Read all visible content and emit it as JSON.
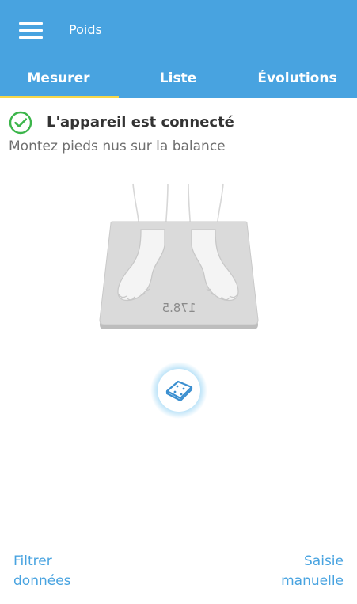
{
  "app": {
    "title": "Poids",
    "menu_icon": "hamburger-menu-icon",
    "header_color": "#48a3e0",
    "tab_indicator_color": "#f7d84a"
  },
  "tabs": [
    {
      "label": "Mesurer",
      "active": true
    },
    {
      "label": "Liste",
      "active": false
    },
    {
      "label": "Évolutions",
      "active": false
    }
  ],
  "status": {
    "icon": "check-circle-icon",
    "icon_color": "#3bb54a",
    "text": "L'appareil est connecté"
  },
  "instruction": "Montez pieds nus sur la balance",
  "scale": {
    "display_value": "178.5",
    "button_icon": "scale-icon"
  },
  "actions": {
    "filter": {
      "line1": "Filtrer",
      "line2": "données"
    },
    "manual": {
      "line1": "Saisie",
      "line2": "manuelle"
    }
  }
}
